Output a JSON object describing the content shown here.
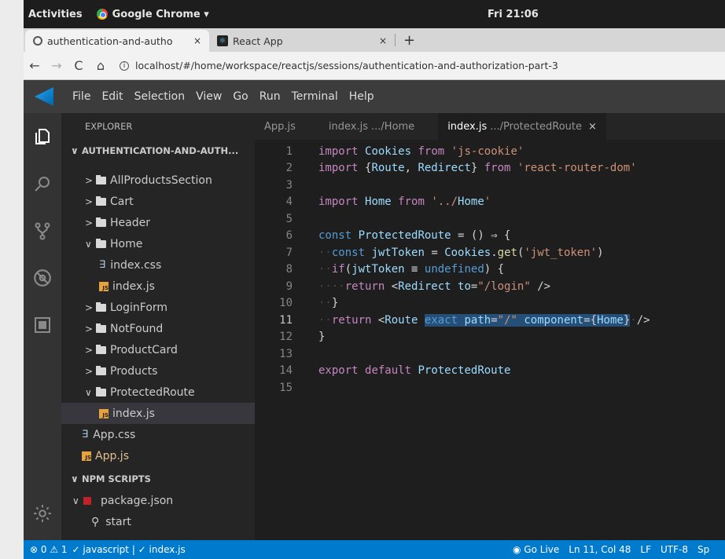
{
  "topbar": {
    "activities": "Activities",
    "app_menu": "Google Chrome ▾",
    "clock": "Fri 21:06"
  },
  "browser": {
    "tabs": [
      {
        "title": "authentication-and-autho",
        "close": "×"
      },
      {
        "title": "React App",
        "close": "×"
      }
    ],
    "new_tab": "+",
    "url": "localhost/#/home/workspace/reactjs/sessions/authentication-and-authorization-part-3"
  },
  "vscode": {
    "menu": [
      "File",
      "Edit",
      "Selection",
      "View",
      "Go",
      "Run",
      "Terminal",
      "Help"
    ],
    "explorer_title": "EXPLORER",
    "project_section": "AUTHENTICATION-AND-AUTH...",
    "npm_section": "NPM SCRIPTS",
    "tree": [
      {
        "label": "AllProductsSection",
        "kind": "folder",
        "chevron": ">",
        "indent": 1
      },
      {
        "label": "Cart",
        "kind": "folder",
        "chevron": ">",
        "indent": 1
      },
      {
        "label": "Header",
        "kind": "folder",
        "chevron": ">",
        "indent": 1
      },
      {
        "label": "Home",
        "kind": "folder",
        "chevron": "∨",
        "indent": 1
      },
      {
        "label": "index.css",
        "kind": "css",
        "chevron": "",
        "indent": 2
      },
      {
        "label": "index.js",
        "kind": "js",
        "chevron": "",
        "indent": 2
      },
      {
        "label": "LoginForm",
        "kind": "folder",
        "chevron": ">",
        "indent": 1
      },
      {
        "label": "NotFound",
        "kind": "folder",
        "chevron": ">",
        "indent": 1
      },
      {
        "label": "ProductCard",
        "kind": "folder",
        "chevron": ">",
        "indent": 1
      },
      {
        "label": "Products",
        "kind": "folder",
        "chevron": ">",
        "indent": 1
      },
      {
        "label": "ProtectedRoute",
        "kind": "folder",
        "chevron": "∨",
        "indent": 1
      },
      {
        "label": "index.js",
        "kind": "js",
        "chevron": "",
        "indent": 2,
        "selected": true
      },
      {
        "label": "App.css",
        "kind": "css",
        "chevron": "",
        "indent": 0
      },
      {
        "label": "App.js",
        "kind": "js",
        "chevron": "",
        "indent": 0
      }
    ],
    "npm": {
      "package": "package.json",
      "script": "start"
    },
    "editor_tabs": [
      {
        "name": "App.js",
        "path": ""
      },
      {
        "name": "index.js",
        "path": ".../Home"
      },
      {
        "name": "index.js",
        "path": ".../ProtectedRoute",
        "active": true,
        "close": "×"
      }
    ],
    "code_lines": [
      {
        "n": "1",
        "t": "import Cookies from 'js-cookie'"
      },
      {
        "n": "2",
        "t": "import {Route, Redirect} from 'react-router-dom'"
      },
      {
        "n": "3",
        "t": ""
      },
      {
        "n": "4",
        "t": "import Home from '../Home'"
      },
      {
        "n": "5",
        "t": ""
      },
      {
        "n": "6",
        "t": "const ProtectedRoute = () ⇒ {"
      },
      {
        "n": "7",
        "t": "  const jwtToken = Cookies.get('jwt_token')"
      },
      {
        "n": "8",
        "t": "  if(jwtToken ≡ undefined) {"
      },
      {
        "n": "9",
        "t": "    return <Redirect to=\"/login\" />"
      },
      {
        "n": "10",
        "t": "  }"
      },
      {
        "n": "11",
        "t": "  return <Route exact path=\"/\" component={Home} />"
      },
      {
        "n": "12",
        "t": "}"
      },
      {
        "n": "13",
        "t": ""
      },
      {
        "n": "14",
        "t": "export default ProtectedRoute"
      },
      {
        "n": "15",
        "t": ""
      }
    ],
    "status": {
      "errors": "0",
      "warnings": "1",
      "left": "✓ javascript | ✓ index.js",
      "go_live": "Go Live",
      "position": "Ln 11, Col 48",
      "eol": "LF",
      "encoding": "UTF-8",
      "spaces": "Sp"
    }
  }
}
